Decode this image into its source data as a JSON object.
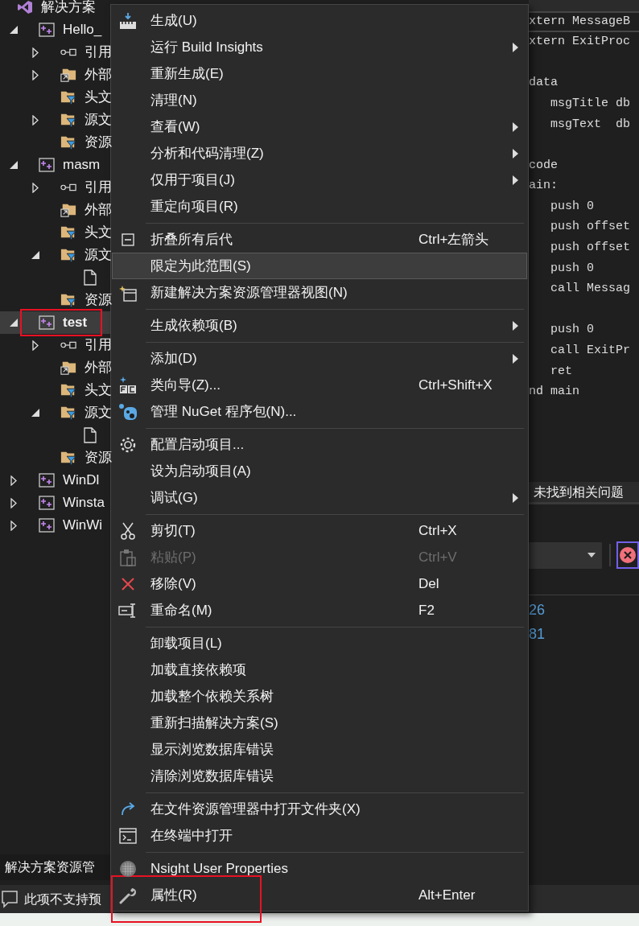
{
  "solution_explorer": {
    "tree": [
      {
        "label": "解决方案",
        "kind": "solution",
        "selected": false,
        "children": [
          {
            "label": "Hello_",
            "kind": "project",
            "expanded": true,
            "selected": false,
            "children": [
              {
                "label": "引用",
                "kind": "references",
                "expanded": false,
                "selected": false
              },
              {
                "label": "外部",
                "kind": "external",
                "expanded": false,
                "selected": false
              },
              {
                "label": "头文",
                "kind": "filter",
                "selected": false
              },
              {
                "label": "源文",
                "kind": "filter",
                "expanded": false,
                "selected": false
              },
              {
                "label": "资源",
                "kind": "filter",
                "selected": false
              }
            ]
          },
          {
            "label": "masm",
            "kind": "project",
            "expanded": true,
            "selected": false,
            "children": [
              {
                "label": "引用",
                "kind": "references",
                "expanded": false,
                "selected": false
              },
              {
                "label": "外部",
                "kind": "external",
                "selected": false
              },
              {
                "label": "头文",
                "kind": "filter",
                "selected": false
              },
              {
                "label": "源文",
                "kind": "filter",
                "expanded": true,
                "selected": false,
                "children": [
                  {
                    "kind": "file",
                    "selected": false
                  }
                ]
              },
              {
                "label": "资源",
                "kind": "filter",
                "selected": false
              }
            ]
          },
          {
            "label": "test",
            "kind": "project",
            "expanded": true,
            "selected": true,
            "marked": true,
            "children": [
              {
                "label": "引用",
                "kind": "references",
                "expanded": false,
                "selected": false
              },
              {
                "label": "外部",
                "kind": "external",
                "selected": false
              },
              {
                "label": "头文",
                "kind": "filter",
                "selected": false
              },
              {
                "label": "源文",
                "kind": "filter",
                "expanded": true,
                "selected": false,
                "children": [
                  {
                    "kind": "file",
                    "selected": false
                  }
                ]
              },
              {
                "label": "资源",
                "kind": "filter",
                "selected": false
              }
            ]
          },
          {
            "label": "WinDl",
            "kind": "project",
            "expanded": false,
            "selected": false
          },
          {
            "label": "Winsta",
            "kind": "project",
            "expanded": false,
            "selected": false
          },
          {
            "label": "WinWi",
            "kind": "project",
            "expanded": false,
            "selected": false
          }
        ]
      }
    ],
    "bottom_tab": "解决方案资源管"
  },
  "editor": {
    "lines": [
      {
        "kind": "code",
        "text": "xtern MessageB",
        "current": true
      },
      {
        "kind": "code",
        "text": "xtern ExitProc",
        "current": false
      },
      {
        "kind": "blank",
        "current": false
      },
      {
        "kind": "code",
        "text": "data",
        "current": false
      },
      {
        "kind": "code",
        "text": "   msgTitle db",
        "current": false
      },
      {
        "kind": "code",
        "text": "   msgText  db",
        "current": false
      },
      {
        "kind": "blank",
        "current": false
      },
      {
        "kind": "code",
        "text": "code",
        "current": false
      },
      {
        "kind": "code",
        "text": "ain:",
        "current": false
      },
      {
        "kind": "code",
        "text": "   push 0",
        "current": false
      },
      {
        "kind": "code",
        "text": "   push offset",
        "current": false
      },
      {
        "kind": "code",
        "text": "   push offset",
        "current": false
      },
      {
        "kind": "code",
        "text": "   push 0",
        "current": false
      },
      {
        "kind": "code",
        "text": "   call Messag",
        "current": false
      },
      {
        "kind": "blank",
        "current": false
      },
      {
        "kind": "code",
        "text": "   push 0",
        "current": false
      },
      {
        "kind": "code",
        "text": "   call ExitPr",
        "current": false
      },
      {
        "kind": "code",
        "text": "   ret",
        "current": false
      },
      {
        "kind": "code",
        "text": "nd main",
        "current": false
      }
    ]
  },
  "issues_bar": {
    "status": "未找到相关问题"
  },
  "output": {
    "lines": [
      "26",
      "81"
    ]
  },
  "status_bar": {
    "text": "此项不支持预"
  },
  "context_menu": {
    "items": [
      {
        "kind": "build",
        "label": "生成(U)",
        "submenu": false,
        "selected": false,
        "disabled": false
      },
      {
        "kind": "plain",
        "label": "运行 Build Insights",
        "submenu": true,
        "selected": false,
        "disabled": false
      },
      {
        "kind": "plain",
        "label": "重新生成(E)",
        "submenu": false,
        "selected": false,
        "disabled": false
      },
      {
        "kind": "plain",
        "label": "清理(N)",
        "submenu": false,
        "selected": false,
        "disabled": false
      },
      {
        "kind": "plain",
        "label": "查看(W)",
        "submenu": true,
        "selected": false,
        "disabled": false
      },
      {
        "kind": "plain",
        "label": "分析和代码清理(Z)",
        "submenu": true,
        "selected": false,
        "disabled": false
      },
      {
        "kind": "plain",
        "label": "仅用于项目(J)",
        "submenu": true,
        "selected": false,
        "disabled": false
      },
      {
        "kind": "plain",
        "label": "重定向项目(R)",
        "submenu": false,
        "selected": false,
        "disabled": false
      },
      {
        "kind": "separator"
      },
      {
        "kind": "collapse",
        "label": "折叠所有后代",
        "shortcut": "Ctrl+左箭头",
        "submenu": false,
        "selected": false,
        "disabled": false
      },
      {
        "kind": "plain",
        "label": "限定为此范围(S)",
        "submenu": false,
        "selected": true,
        "disabled": false
      },
      {
        "kind": "newview",
        "label": "新建解决方案资源管理器视图(N)",
        "submenu": false,
        "selected": false,
        "disabled": false
      },
      {
        "kind": "separator"
      },
      {
        "kind": "plain",
        "label": "生成依赖项(B)",
        "submenu": true,
        "selected": false,
        "disabled": false
      },
      {
        "kind": "separator"
      },
      {
        "kind": "plain",
        "label": "添加(D)",
        "submenu": true,
        "selected": false,
        "disabled": false
      },
      {
        "kind": "wizard",
        "label": "类向导(Z)...",
        "shortcut": "Ctrl+Shift+X",
        "submenu": false,
        "selected": false,
        "disabled": false
      },
      {
        "kind": "nuget",
        "label": "管理 NuGet 程序包(N)...",
        "submenu": false,
        "selected": false,
        "disabled": false
      },
      {
        "kind": "separator"
      },
      {
        "kind": "gear",
        "label": "配置启动项目...",
        "submenu": false,
        "selected": false,
        "disabled": false
      },
      {
        "kind": "plain",
        "label": "设为启动项目(A)",
        "submenu": false,
        "selected": false,
        "disabled": false
      },
      {
        "kind": "plain",
        "label": "调试(G)",
        "submenu": true,
        "selected": false,
        "disabled": false
      },
      {
        "kind": "separator"
      },
      {
        "kind": "scissors",
        "label": "剪切(T)",
        "shortcut": "Ctrl+X",
        "submenu": false,
        "selected": false,
        "disabled": false
      },
      {
        "kind": "clipboard",
        "label": "粘贴(P)",
        "shortcut": "Ctrl+V",
        "submenu": false,
        "selected": false,
        "disabled": true
      },
      {
        "kind": "remove",
        "label": "移除(V)",
        "shortcut": "Del",
        "submenu": false,
        "selected": false,
        "disabled": false
      },
      {
        "kind": "rename",
        "label": "重命名(M)",
        "shortcut": "F2",
        "submenu": false,
        "selected": false,
        "disabled": false
      },
      {
        "kind": "separator"
      },
      {
        "kind": "plain",
        "label": "卸载项目(L)",
        "submenu": false,
        "selected": false,
        "disabled": false
      },
      {
        "kind": "plain",
        "label": "加载直接依赖项",
        "submenu": false,
        "selected": false,
        "disabled": false
      },
      {
        "kind": "plain",
        "label": "加载整个依赖关系树",
        "submenu": false,
        "selected": false,
        "disabled": false
      },
      {
        "kind": "plain",
        "label": "重新扫描解决方案(S)",
        "submenu": false,
        "selected": false,
        "disabled": false
      },
      {
        "kind": "plain",
        "label": "显示浏览数据库错误",
        "submenu": false,
        "selected": false,
        "disabled": false
      },
      {
        "kind": "plain",
        "label": "清除浏览数据库错误",
        "submenu": false,
        "selected": false,
        "disabled": false
      },
      {
        "kind": "separator"
      },
      {
        "kind": "openfolder",
        "label": "在文件资源管理器中打开文件夹(X)",
        "submenu": false,
        "selected": false,
        "disabled": false
      },
      {
        "kind": "terminal",
        "label": "在终端中打开",
        "submenu": false,
        "selected": false,
        "disabled": false
      },
      {
        "kind": "separator"
      },
      {
        "kind": "globe",
        "label": "Nsight User Properties",
        "submenu": false,
        "selected": false,
        "disabled": false
      },
      {
        "kind": "wrench",
        "label": "属性(R)",
        "shortcut": "Alt+Enter",
        "submenu": false,
        "selected": false,
        "disabled": false,
        "marked": true
      }
    ]
  }
}
